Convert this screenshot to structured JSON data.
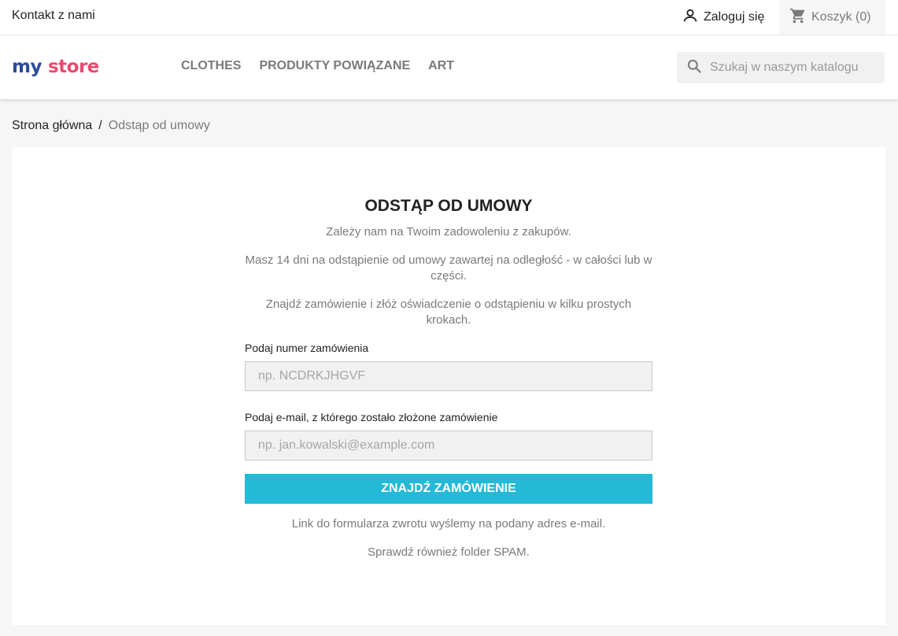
{
  "topbar": {
    "contact": "Kontakt z nami",
    "login": "Zaloguj się",
    "cart": "Koszyk (0)"
  },
  "logo": {
    "word1": "my",
    "word2": "store"
  },
  "nav": {
    "items": [
      "CLOTHES",
      "PRODUKTY POWIĄZANE",
      "ART"
    ]
  },
  "search": {
    "placeholder": "Szukaj w naszym katalogu"
  },
  "breadcrumb": {
    "home": "Strona główna",
    "separator": "/",
    "current": "Odstąp od umowy"
  },
  "main": {
    "title": "ODSTĄP OD UMOWY",
    "p1": "Zależy nam na Twoim zadowoleniu z zakupów.",
    "p2": "Masz 14 dni na odstąpienie od umowy zawartej na odległość - w całości lub w części.",
    "p3": "Znajdź zamówienie i złóż oświadczenie o odstąpieniu w kilku prostych krokach.",
    "order_label": "Podaj numer zamówienia",
    "order_placeholder": "np. NCDRKJHGVF",
    "email_label": "Podaj e-mail, z którego zostało złożone zamówienie",
    "email_placeholder": "np. jan.kowalski@example.com",
    "button": "ZNAJDŹ ZAMÓWIENIE",
    "p4": "Link do formularza zwrotu wyślemy na podany adres e-mail.",
    "p5": "Sprawdź również folder SPAM."
  },
  "colors": {
    "accent": "#24b9d7",
    "logo_my": "#2a4a9a",
    "logo_store": "#e84a6f"
  }
}
